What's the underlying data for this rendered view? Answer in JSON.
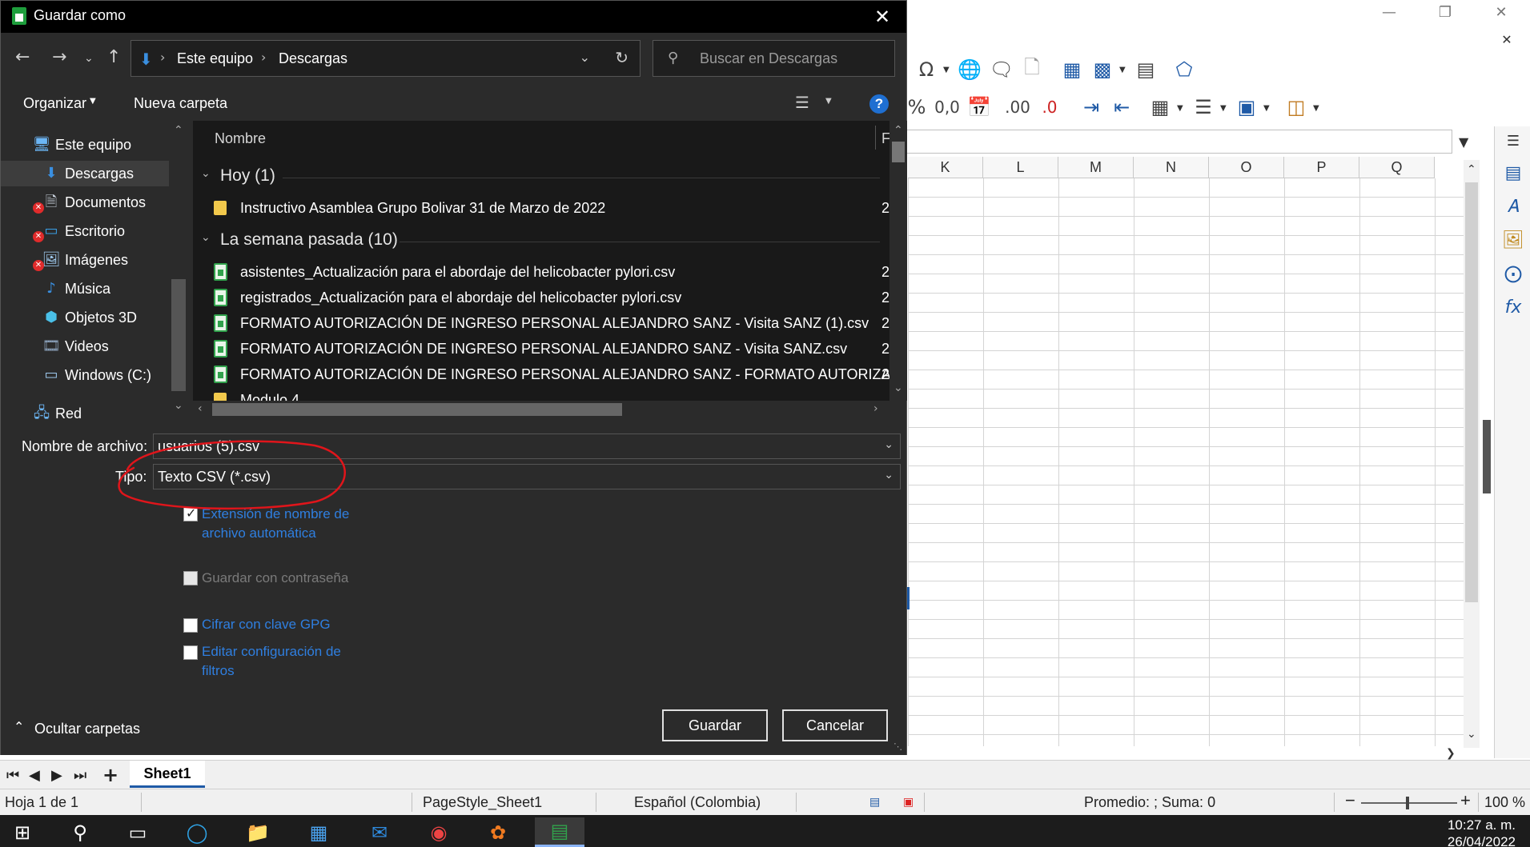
{
  "calc": {
    "column_headers": [
      "K",
      "L",
      "M",
      "N",
      "O",
      "P",
      "Q"
    ],
    "sheet_tab": "Sheet1",
    "status": {
      "page": "Hoja 1 de 1",
      "page_style": "PageStyle_Sheet1",
      "language": "Español (Colombia)",
      "summary": "Promedio: ; Suma: 0",
      "zoom": "100 %"
    },
    "clock": {
      "time": "10:27 a. m.",
      "date": "26/04/2022"
    }
  },
  "dialog": {
    "title": "Guardar como",
    "address": {
      "root": "Este equipo",
      "current": "Descargas"
    },
    "search_placeholder": "Buscar en Descargas",
    "commands": {
      "organize": "Organizar",
      "new_folder": "Nueva carpeta",
      "help": "?"
    },
    "nav_items": [
      {
        "label": "Este equipo",
        "icon": "computer-icon"
      },
      {
        "label": "Descargas",
        "icon": "download-folder-icon"
      },
      {
        "label": "Documentos",
        "icon": "documents-folder-icon"
      },
      {
        "label": "Escritorio",
        "icon": "desktop-folder-icon"
      },
      {
        "label": "Imágenes",
        "icon": "pictures-folder-icon"
      },
      {
        "label": "Música",
        "icon": "music-folder-icon"
      },
      {
        "label": "Objetos 3D",
        "icon": "3d-objects-icon"
      },
      {
        "label": "Videos",
        "icon": "videos-folder-icon"
      },
      {
        "label": "Windows (C:)",
        "icon": "drive-icon"
      },
      {
        "label": "Red",
        "icon": "network-icon"
      }
    ],
    "file_list": {
      "column_name": "Nombre",
      "column_second": "F",
      "groups": [
        {
          "header": "Hoy (1)",
          "files": [
            {
              "name": "Instructivo Asamblea Grupo Bolivar 31 de Marzo de 2022",
              "type": "folder",
              "col2": "2"
            }
          ]
        },
        {
          "header": "La semana pasada (10)",
          "files": [
            {
              "name": "asistentes_Actualización para el abordaje del helicobacter pylori.csv",
              "type": "csv",
              "col2": "2"
            },
            {
              "name": "registrados_Actualización para el abordaje del helicobacter pylori.csv",
              "type": "csv",
              "col2": "2"
            },
            {
              "name": "FORMATO AUTORIZACIÓN DE INGRESO PERSONAL ALEJANDRO SANZ - Visita SANZ (1).csv",
              "type": "csv",
              "col2": "2"
            },
            {
              "name": "FORMATO AUTORIZACIÓN DE INGRESO PERSONAL ALEJANDRO SANZ - Visita SANZ.csv",
              "type": "csv",
              "col2": "2"
            },
            {
              "name": "FORMATO AUTORIZACIÓN DE INGRESO PERSONAL ALEJANDRO SANZ - FORMATO AUTORIZACI...",
              "type": "csv",
              "col2": "2"
            },
            {
              "name": "Modulo 4",
              "type": "folder",
              "col2": ""
            }
          ]
        }
      ]
    },
    "filename_label": "Nombre de archivo:",
    "filename_value": "usuarios (5).csv",
    "type_label": "Tipo:",
    "type_value": "Texto CSV (*.csv)",
    "options": [
      {
        "label": "Extensión de nombre de archivo automática",
        "checked": true,
        "enabled": true
      },
      {
        "label": "Guardar con contraseña",
        "checked": false,
        "enabled": false
      },
      {
        "label": "Cifrar con clave GPG",
        "checked": false,
        "enabled": true
      },
      {
        "label": "Editar configuración de filtros",
        "checked": false,
        "enabled": true
      }
    ],
    "save_button": "Guardar",
    "cancel_button": "Cancelar",
    "hide_folders": "Ocultar carpetas"
  },
  "colors": {
    "annotation": "#e0151b",
    "accent": "#1f6fd1",
    "link": "#2f7fe0"
  }
}
